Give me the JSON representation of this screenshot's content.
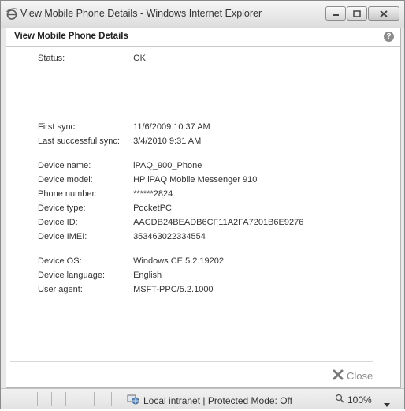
{
  "window": {
    "title": "View Mobile Phone Details - Windows Internet Explorer"
  },
  "dialog": {
    "title": "View Mobile Phone Details",
    "help_label": "?",
    "status": {
      "label": "Status:",
      "value": "OK"
    },
    "sync": [
      {
        "label": "First sync:",
        "value": "11/6/2009 10:37 AM"
      },
      {
        "label": "Last successful sync:",
        "value": "3/4/2010 9:31 AM"
      }
    ],
    "device": [
      {
        "label": "Device name:",
        "value": "iPAQ_900_Phone"
      },
      {
        "label": "Device model:",
        "value": "HP iPAQ Mobile Messenger 910"
      },
      {
        "label": "Phone number:",
        "value": "******2824"
      },
      {
        "label": "Device type:",
        "value": "PocketPC"
      },
      {
        "label": "Device ID:",
        "value": "AACDB24BEADB6CF11A2FA7201B6E9276"
      },
      {
        "label": "Device IMEI:",
        "value": "353463022334554"
      }
    ],
    "system": [
      {
        "label": "Device OS:",
        "value": "Windows CE 5.2.19202"
      },
      {
        "label": "Device language:",
        "value": "English"
      },
      {
        "label": "User agent:",
        "value": "MSFT-PPC/5.2.1000"
      }
    ],
    "close_label": "Close"
  },
  "statusbar": {
    "zone": "Local intranet | Protected Mode: Off",
    "zoom": "100%"
  },
  "colors": {
    "close_x": "#7a7a7a",
    "ie_blue": "#3b7bd3"
  }
}
